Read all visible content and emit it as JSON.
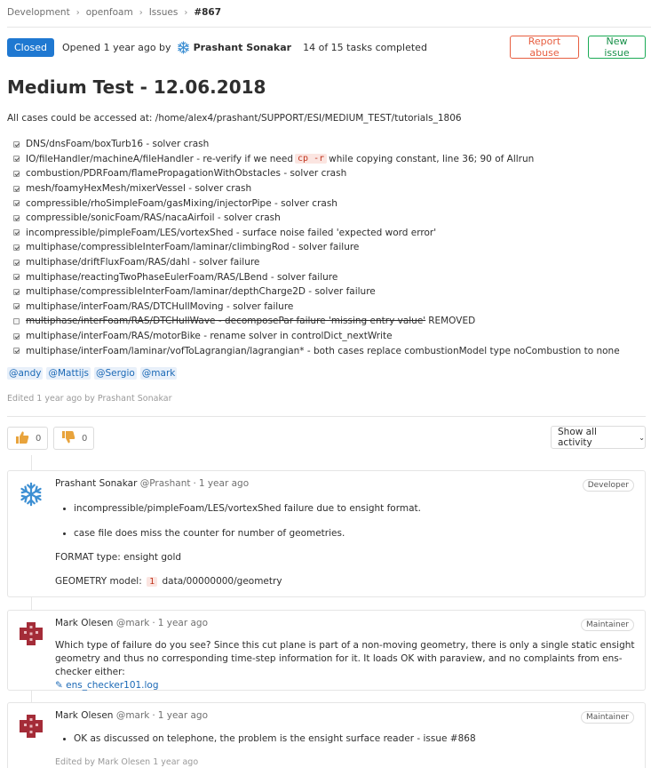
{
  "breadcrumb": {
    "items": [
      "Development",
      "openfoam",
      "Issues"
    ],
    "current": "#867"
  },
  "issue": {
    "status": "Closed",
    "opened_text": "Opened 1 year ago by",
    "author": "Prashant Sonakar",
    "tasks_status": "14 of 15 tasks completed",
    "report_button": "Report abuse",
    "new_issue_button": "New issue",
    "title": "Medium Test - 12.06.2018",
    "intro": "All cases could be accessed at: /home/alex4/prashant/SUPPORT/ESI/MEDIUM_TEST/tutorials_1806",
    "tasks": [
      {
        "checked": true,
        "text": "DNS/dnsFoam/boxTurb16 - solver crash"
      },
      {
        "checked": true,
        "text": "IO/fileHandler/machineA/fileHandler - re-verify if we need",
        "code": "cp -r",
        "text_after": "while copying constant, line 36; 90 of Allrun"
      },
      {
        "checked": true,
        "text": "combustion/PDRFoam/flamePropagationWithObstacles - solver crash"
      },
      {
        "checked": true,
        "text": "mesh/foamyHexMesh/mixerVessel - solver crash"
      },
      {
        "checked": true,
        "text": "compressible/rhoSimpleFoam/gasMixing/injectorPipe - solver crash"
      },
      {
        "checked": true,
        "text": "compressible/sonicFoam/RAS/nacaAirfoil - solver crash"
      },
      {
        "checked": true,
        "text": "incompressible/pimpleFoam/LES/vortexShed - surface noise failed 'expected word error'"
      },
      {
        "checked": true,
        "text": "multiphase/compressibleInterFoam/laminar/climbingRod - solver failure"
      },
      {
        "checked": true,
        "text": "multiphase/driftFluxFoam/RAS/dahl - solver failure"
      },
      {
        "checked": true,
        "text": "multiphase/reactingTwoPhaseEulerFoam/RAS/LBend - solver failure"
      },
      {
        "checked": true,
        "text": "multiphase/compressibleInterFoam/laminar/depthCharge2D - solver failure"
      },
      {
        "checked": true,
        "text": "multiphase/interFoam/RAS/DTCHullMoving - solver failure"
      },
      {
        "checked": false,
        "struck": "multiphase/interFoam/RAS/DTCHullWave - decomposePar failure 'missing entry value'",
        "text_after": "REMOVED"
      },
      {
        "checked": true,
        "text": "multiphase/interFoam/RAS/motorBike - rename solver in controlDict_nextWrite"
      },
      {
        "checked": true,
        "text": "multiphase/interFoam/laminar/vofToLagrangian/lagrangian* - both cases replace combustionModel type noCombustion to none"
      }
    ],
    "mentions": [
      "@andy",
      "@Mattijs",
      "@Sergio",
      "@mark"
    ],
    "edited": "Edited 1 year ago by Prashant Sonakar"
  },
  "awards": {
    "thumbs_up": "0",
    "thumbs_down": "0"
  },
  "activity_filter": "Show all activity",
  "notes": [
    {
      "author": "Prashant Sonakar",
      "handle": "@Prashant",
      "time": "1 year ago",
      "role": "Developer",
      "bullets": [
        "incompressible/pimpleFoam/LES/vortexShed failure due to ensight format.",
        "case file does miss the counter for number of geometries."
      ],
      "format_line": "FORMAT type: ensight gold",
      "geometry_prefix": "GEOMETRY model:",
      "geometry_code": "1",
      "geometry_suffix": "data/00000000/geometry"
    },
    {
      "author": "Mark Olesen",
      "handle": "@mark",
      "time": "1 year ago",
      "role": "Maintainer",
      "text": "Which type of failure do you see? Since this cut plane is part of a non-moving geometry, there is only a single static ensight geometry and thus no corresponding time-step information for it. It loads OK with paraview, and no complaints from ens-checker either:",
      "attachment": "ens_checker101.log"
    },
    {
      "author": "Mark Olesen",
      "handle": "@mark",
      "time": "1 year ago",
      "role": "Maintainer",
      "bullets": [
        "OK as discussed on telephone, the problem is the ensight surface reader - issue #868"
      ],
      "edited": "Edited by Mark Olesen 1 year ago"
    }
  ],
  "icons": {
    "accent": "#1f78d1",
    "thumbs": "#e8a33c",
    "avatar_red": "#a42c38",
    "avatar_blue": "#3d8fd3"
  }
}
